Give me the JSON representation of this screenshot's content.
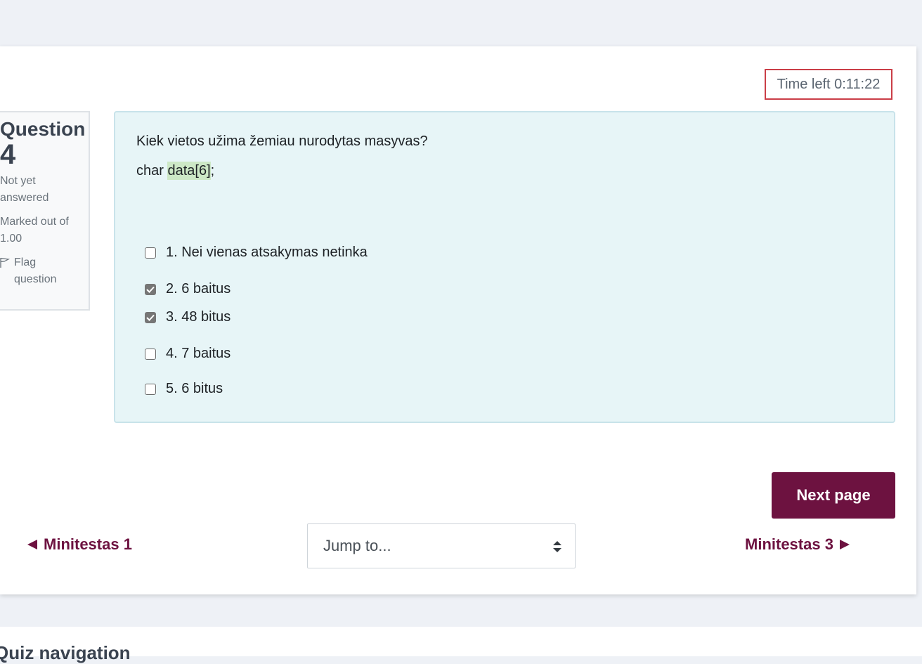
{
  "timer": {
    "text": "Time left 0:11:22"
  },
  "question_info": {
    "label": "Question",
    "number": "4",
    "state_line1": "Not yet",
    "state_line2": "answered",
    "grade_line1": "Marked out of",
    "grade_line2": "1.00",
    "flag_line1": "Flag",
    "flag_line2": "question"
  },
  "question": {
    "text": "Kiek vietos užima žemiau nurodytas masyvas?",
    "code_prefix": "char ",
    "code_highlight": "data[6]",
    "code_suffix": ";",
    "answers": [
      {
        "label": "1. Nei vienas atsakymas netinka",
        "checked": false
      },
      {
        "label": "2. 6 baitus",
        "checked": true
      },
      {
        "label": "3. 48 bitus",
        "checked": true
      },
      {
        "label": "4. 7 baitus",
        "checked": false
      },
      {
        "label": "5. 6 bitus",
        "checked": false
      }
    ]
  },
  "buttons": {
    "next_page": "Next page"
  },
  "navigation": {
    "prev_label": "Minitestas 1",
    "jump_placeholder": "Jump to...",
    "next_label": "Minitestas 3"
  },
  "bottom": {
    "title": "Quiz navigation"
  },
  "colors": {
    "brand": "#6d1240",
    "timer_border": "#ca3e47",
    "formulation_bg": "#e7f5f7",
    "highlight": "#cde8c6"
  }
}
